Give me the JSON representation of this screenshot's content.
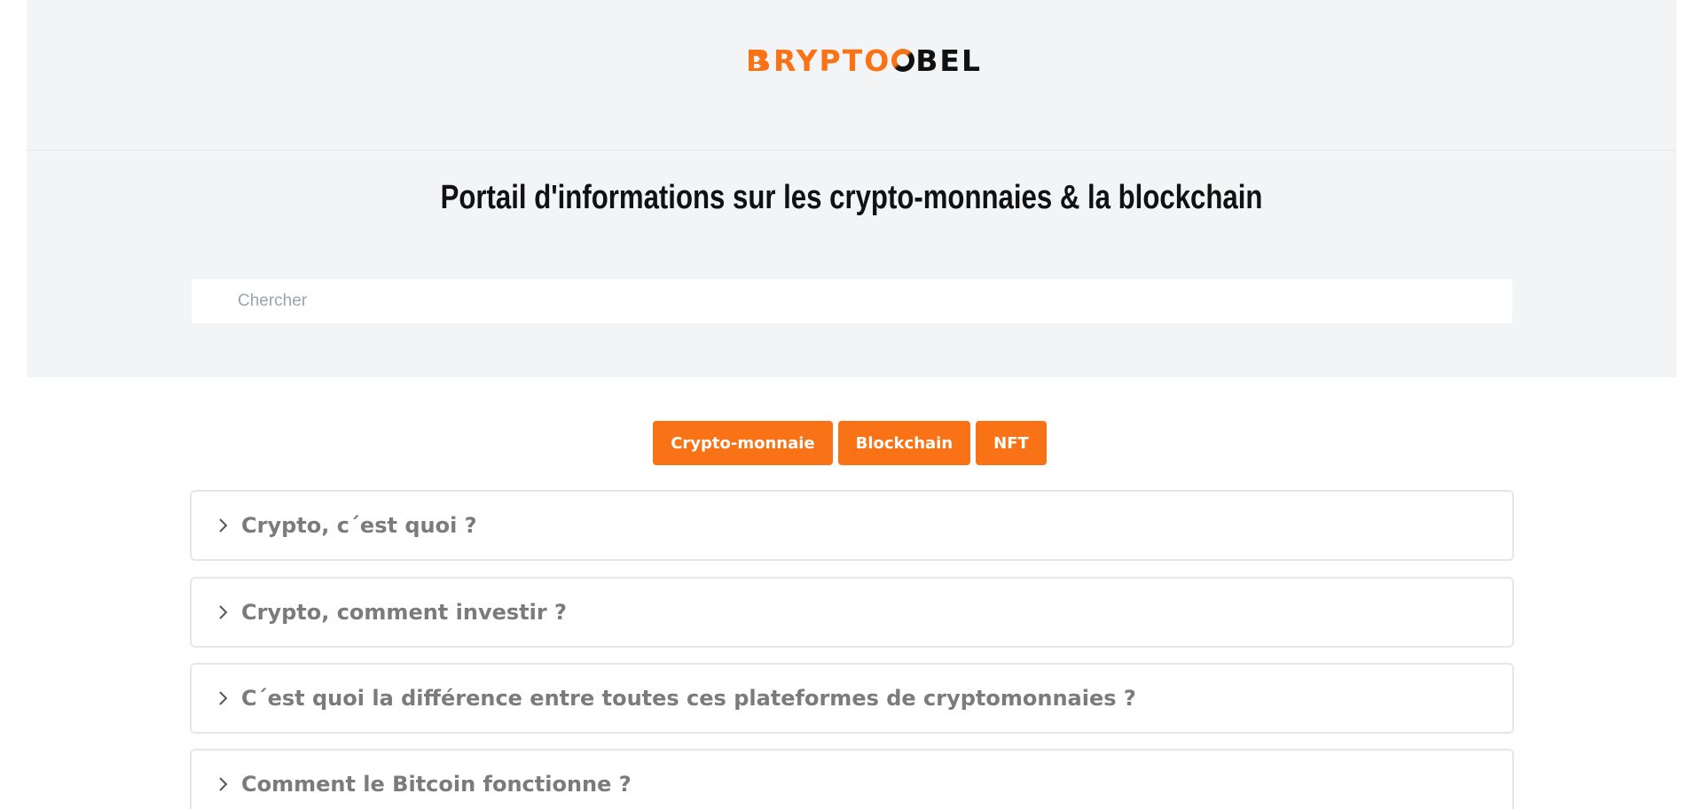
{
  "header": {
    "logo_text_orange": "RYPTO",
    "logo_text_dark": "BEL",
    "logo_brand": "BRYPTOBEL",
    "headline": "Portail d'informations sur les crypto-monnaies & la blockchain"
  },
  "search": {
    "placeholder": "Chercher",
    "value": ""
  },
  "categories": [
    {
      "label": "Crypto-monnaie"
    },
    {
      "label": "Blockchain"
    },
    {
      "label": "NFT"
    }
  ],
  "faq": [
    {
      "question": "Crypto, c´est quoi ?"
    },
    {
      "question": "Crypto, comment investir ?"
    },
    {
      "question": "C´est quoi la différence entre toutes ces plateformes de cryptomonnaies ?"
    },
    {
      "question": "Comment le Bitcoin fonctionne ?"
    }
  ],
  "colors": {
    "accent": "#f97316",
    "hero_bg": "#f3f4f6",
    "faq_text": "#7b7b7b"
  },
  "icons": {
    "search": "search-icon",
    "faq_toggle": "chevron-right-icon"
  }
}
